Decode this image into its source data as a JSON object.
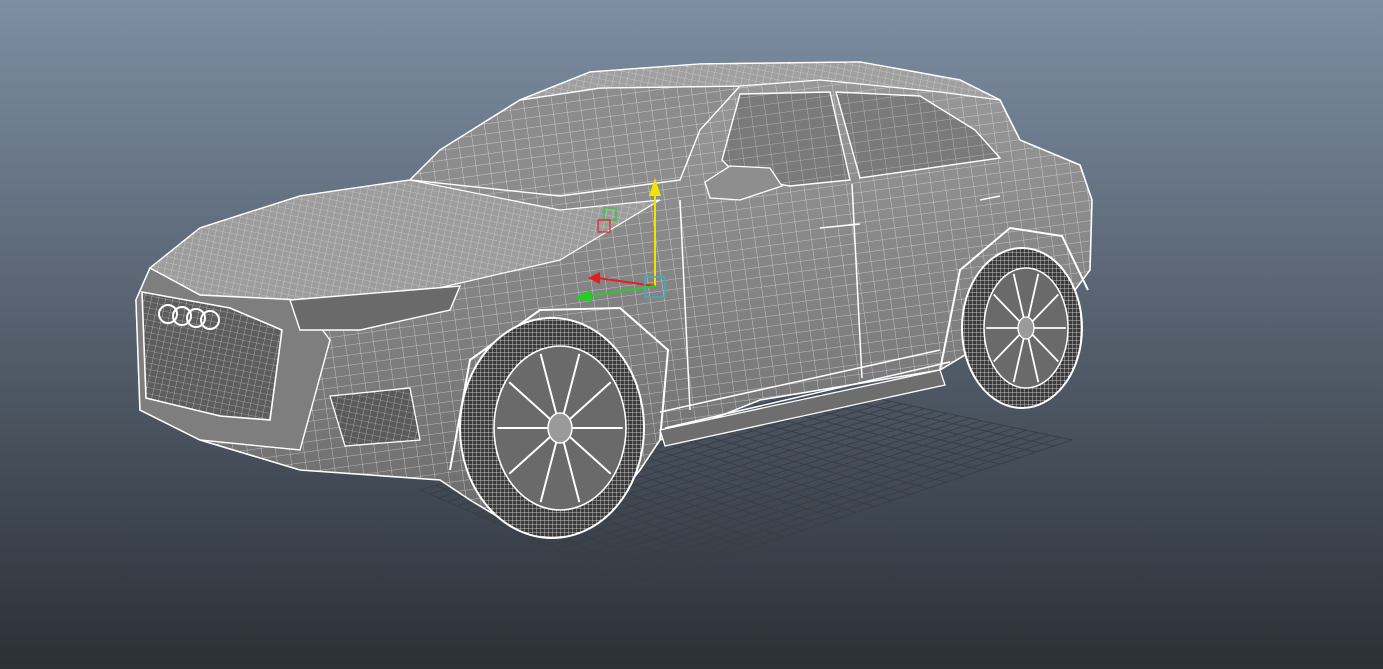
{
  "viewport": {
    "background_top": "#7d8ea3",
    "background_bottom": "#2b3036",
    "grid_color": "#3a3f45",
    "wire_color": "#ffffff",
    "shade_color": "#8a8a8a",
    "shade_dark": "#5c5c5c"
  },
  "gizmo": {
    "x_axis_color": "#e02020",
    "y_axis_color": "#f2e400",
    "z_axis_color": "#22d022",
    "center_color": "#3ab0c0"
  },
  "model": {
    "grille_badge": "four-rings-logo"
  }
}
